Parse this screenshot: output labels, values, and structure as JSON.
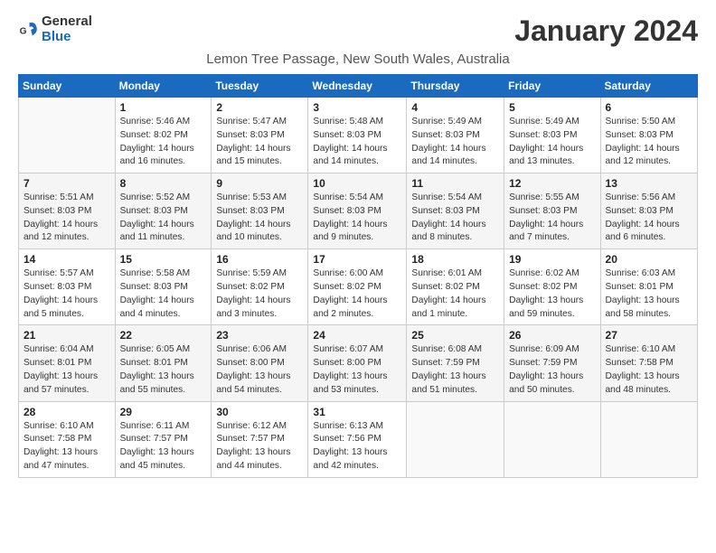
{
  "header": {
    "logo_general": "General",
    "logo_blue": "Blue",
    "month_title": "January 2024",
    "location": "Lemon Tree Passage, New South Wales, Australia"
  },
  "days_of_week": [
    "Sunday",
    "Monday",
    "Tuesday",
    "Wednesday",
    "Thursday",
    "Friday",
    "Saturday"
  ],
  "weeks": [
    [
      {
        "day": "",
        "content": ""
      },
      {
        "day": "1",
        "content": "Sunrise: 5:46 AM\nSunset: 8:02 PM\nDaylight: 14 hours\nand 16 minutes."
      },
      {
        "day": "2",
        "content": "Sunrise: 5:47 AM\nSunset: 8:03 PM\nDaylight: 14 hours\nand 15 minutes."
      },
      {
        "day": "3",
        "content": "Sunrise: 5:48 AM\nSunset: 8:03 PM\nDaylight: 14 hours\nand 14 minutes."
      },
      {
        "day": "4",
        "content": "Sunrise: 5:49 AM\nSunset: 8:03 PM\nDaylight: 14 hours\nand 14 minutes."
      },
      {
        "day": "5",
        "content": "Sunrise: 5:49 AM\nSunset: 8:03 PM\nDaylight: 14 hours\nand 13 minutes."
      },
      {
        "day": "6",
        "content": "Sunrise: 5:50 AM\nSunset: 8:03 PM\nDaylight: 14 hours\nand 12 minutes."
      }
    ],
    [
      {
        "day": "7",
        "content": "Sunrise: 5:51 AM\nSunset: 8:03 PM\nDaylight: 14 hours\nand 12 minutes."
      },
      {
        "day": "8",
        "content": "Sunrise: 5:52 AM\nSunset: 8:03 PM\nDaylight: 14 hours\nand 11 minutes."
      },
      {
        "day": "9",
        "content": "Sunrise: 5:53 AM\nSunset: 8:03 PM\nDaylight: 14 hours\nand 10 minutes."
      },
      {
        "day": "10",
        "content": "Sunrise: 5:54 AM\nSunset: 8:03 PM\nDaylight: 14 hours\nand 9 minutes."
      },
      {
        "day": "11",
        "content": "Sunrise: 5:54 AM\nSunset: 8:03 PM\nDaylight: 14 hours\nand 8 minutes."
      },
      {
        "day": "12",
        "content": "Sunrise: 5:55 AM\nSunset: 8:03 PM\nDaylight: 14 hours\nand 7 minutes."
      },
      {
        "day": "13",
        "content": "Sunrise: 5:56 AM\nSunset: 8:03 PM\nDaylight: 14 hours\nand 6 minutes."
      }
    ],
    [
      {
        "day": "14",
        "content": "Sunrise: 5:57 AM\nSunset: 8:03 PM\nDaylight: 14 hours\nand 5 minutes."
      },
      {
        "day": "15",
        "content": "Sunrise: 5:58 AM\nSunset: 8:03 PM\nDaylight: 14 hours\nand 4 minutes."
      },
      {
        "day": "16",
        "content": "Sunrise: 5:59 AM\nSunset: 8:02 PM\nDaylight: 14 hours\nand 3 minutes."
      },
      {
        "day": "17",
        "content": "Sunrise: 6:00 AM\nSunset: 8:02 PM\nDaylight: 14 hours\nand 2 minutes."
      },
      {
        "day": "18",
        "content": "Sunrise: 6:01 AM\nSunset: 8:02 PM\nDaylight: 14 hours\nand 1 minute."
      },
      {
        "day": "19",
        "content": "Sunrise: 6:02 AM\nSunset: 8:02 PM\nDaylight: 13 hours\nand 59 minutes."
      },
      {
        "day": "20",
        "content": "Sunrise: 6:03 AM\nSunset: 8:01 PM\nDaylight: 13 hours\nand 58 minutes."
      }
    ],
    [
      {
        "day": "21",
        "content": "Sunrise: 6:04 AM\nSunset: 8:01 PM\nDaylight: 13 hours\nand 57 minutes."
      },
      {
        "day": "22",
        "content": "Sunrise: 6:05 AM\nSunset: 8:01 PM\nDaylight: 13 hours\nand 55 minutes."
      },
      {
        "day": "23",
        "content": "Sunrise: 6:06 AM\nSunset: 8:00 PM\nDaylight: 13 hours\nand 54 minutes."
      },
      {
        "day": "24",
        "content": "Sunrise: 6:07 AM\nSunset: 8:00 PM\nDaylight: 13 hours\nand 53 minutes."
      },
      {
        "day": "25",
        "content": "Sunrise: 6:08 AM\nSunset: 7:59 PM\nDaylight: 13 hours\nand 51 minutes."
      },
      {
        "day": "26",
        "content": "Sunrise: 6:09 AM\nSunset: 7:59 PM\nDaylight: 13 hours\nand 50 minutes."
      },
      {
        "day": "27",
        "content": "Sunrise: 6:10 AM\nSunset: 7:58 PM\nDaylight: 13 hours\nand 48 minutes."
      }
    ],
    [
      {
        "day": "28",
        "content": "Sunrise: 6:10 AM\nSunset: 7:58 PM\nDaylight: 13 hours\nand 47 minutes."
      },
      {
        "day": "29",
        "content": "Sunrise: 6:11 AM\nSunset: 7:57 PM\nDaylight: 13 hours\nand 45 minutes."
      },
      {
        "day": "30",
        "content": "Sunrise: 6:12 AM\nSunset: 7:57 PM\nDaylight: 13 hours\nand 44 minutes."
      },
      {
        "day": "31",
        "content": "Sunrise: 6:13 AM\nSunset: 7:56 PM\nDaylight: 13 hours\nand 42 minutes."
      },
      {
        "day": "",
        "content": ""
      },
      {
        "day": "",
        "content": ""
      },
      {
        "day": "",
        "content": ""
      }
    ]
  ]
}
